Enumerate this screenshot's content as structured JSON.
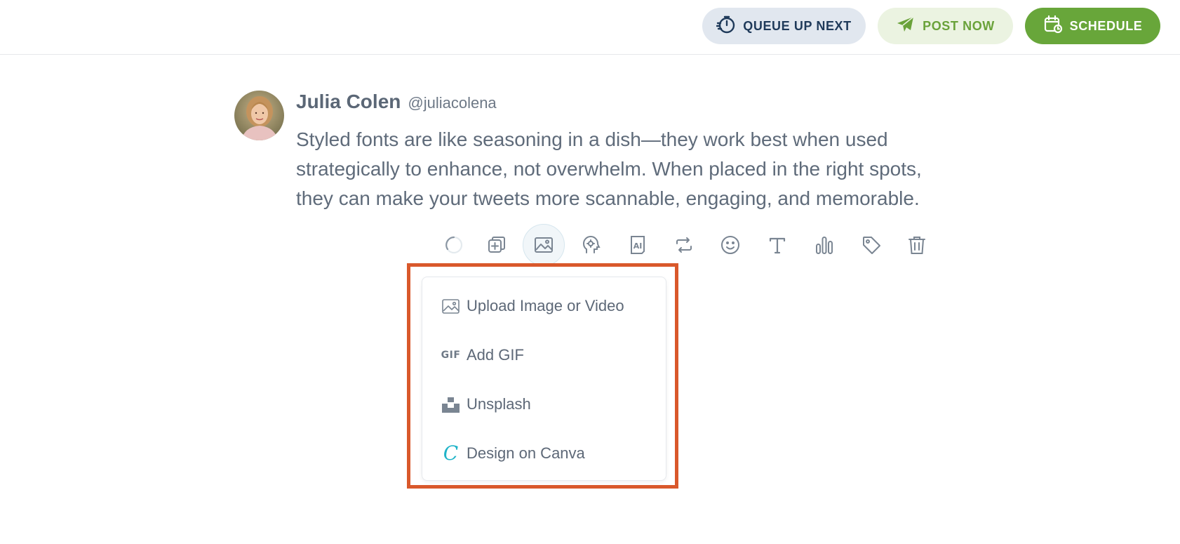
{
  "header": {
    "queue_label": "QUEUE UP NEXT",
    "post_label": "POST NOW",
    "schedule_label": "SCHEDULE"
  },
  "tweet": {
    "author_name": "Julia Colen",
    "author_handle": "@juliacolena",
    "text": "Styled fonts are like seasoning in a dish—they work best when used strategically to enhance, not overwhelm. When placed in the right spots, they can make your tweets more scannable, engaging, and memorable."
  },
  "toolbar": {
    "tools": [
      "loading",
      "add-thread",
      "media",
      "hook-generator",
      "ai",
      "retweet",
      "emoji",
      "text-style",
      "poll",
      "tag",
      "delete"
    ],
    "active": "media"
  },
  "media_menu": {
    "items": [
      {
        "label": "Upload Image or Video",
        "icon": "image-icon"
      },
      {
        "label": "Add GIF",
        "icon": "gif-icon",
        "icon_text": "GIF"
      },
      {
        "label": "Unsplash",
        "icon": "unsplash-icon"
      },
      {
        "label": "Design on Canva",
        "icon": "canva-icon",
        "icon_text": "C"
      }
    ]
  },
  "colors": {
    "highlight": "#d9582b",
    "accent_green": "#68a63a",
    "queue_bg": "#e1e7ef",
    "text": "#5f6b7a"
  }
}
